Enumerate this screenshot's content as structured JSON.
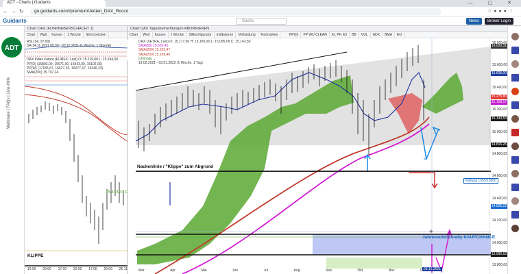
{
  "browser": {
    "tab_title": "ADT - Charts | Guidants",
    "url": "go.guidants.com/#premium/Aktien_DAX_Rocco"
  },
  "app": {
    "logo": "Guidants",
    "search_placeholder": "Suche",
    "news_label": "News",
    "broker_label": "Broker Login"
  },
  "left_strip": {
    "badge": "ADT",
    "vertical_text": "Webinare | FAQs | Live-Hilfe"
  },
  "left_chart": {
    "title": "Chart DAX (FUNKNEBENSCHACHT 1)",
    "toolbar": [
      "Chart",
      "Watt",
      "Kursen",
      "1 Woche",
      "Strichzeichen"
    ],
    "legend": [
      "RSI (14, 37.00)",
      "DA 14.11.2021 05:30 - 03.12.2021 (1 Woche, 1 Stunde)",
      "DAX Index Future (EUREX, Last) O: 15.119,00 L: 15.194,00",
      "PP(D) (15893,00, 15971,00, 15543,00, 15102,00)",
      "PP(W) (17185,67, 16627,33, 16077,67, 15346,33)",
      "SMA(200) 15.797,24"
    ],
    "price_label": "15.449,33 D",
    "klippe_label": "KLIPPE",
    "x_ticks": [
      "16:00",
      "20:00",
      "17:00",
      "20:00",
      "17:00",
      "20:00",
      "26.11"
    ]
  },
  "main_chart": {
    "title": "Chart DAX Tagesbetrachtungen ABONNIEREN",
    "toolbar": [
      "Chart",
      "Wert",
      "Kursen",
      "1 Woche",
      "Stilkonfigurator",
      "Indikatoren",
      "Verbindung",
      "Textmarken"
    ],
    "toolbar_right": [
      "PP(D)",
      "PP WU CLEAN",
      "KI, PF, E3",
      "BB",
      "VOL",
      "ADX",
      "BMA",
      "EO"
    ],
    "legend": [
      "DAX (XETRA, Last) O: 15.177,50 H: 15.185,00 L: 15.095,05 C: 15.143,50",
      "SMA(50) 15.535,45",
      "SMA(200) 15.222,47",
      "SMA(200) 15.169,40",
      "Ichimoku ..",
      "19.02.2021 - 03.01.2022 (1 Woche, 1 Tag)"
    ],
    "price_axis": [
      "16.020,00",
      "15.600,00",
      "15.400,00",
      "15.200,00",
      "15.000,00",
      "14.800,00",
      "14.600,00",
      "14.400,00",
      "14.200,00",
      "14.000,00",
      "13.800,00"
    ],
    "price_labels": [
      {
        "text": "16.020,31",
        "color": "#333333"
      },
      {
        "text": "15.605,00",
        "color": "#1f3f9f"
      },
      {
        "text": "15.275,80",
        "color": "#e53935"
      },
      {
        "text": "15.158,57",
        "color": "#c21fd1"
      },
      {
        "text": "15.143,50",
        "color": "#1a1a1a"
      },
      {
        "text": "14.816,26",
        "color": "#1a1a1a"
      },
      {
        "text": "14.505,22",
        "color": "#1f6fd1"
      },
      {
        "text": "13.996,62",
        "color": "#1a1a1a"
      }
    ],
    "annotations": {
      "neckline": "Nackenlinie / \"Klippe\" zum Abgrund",
      "range": "Rallung 1350/13800",
      "rally": "Jahresschlussrally KAUFCHANCE"
    },
    "x_axis": [
      "Mär",
      "Apr",
      "Mai",
      "Jun",
      "Jul",
      "Aug",
      "Sep",
      "Okt",
      "Nov",
      "Dez"
    ],
    "date_marker": "03.12.2021",
    "colors": {
      "cloud_green": "#5aa832",
      "cloud_red": "#e05a5a",
      "sma_red": "#c0392b",
      "sma_magenta": "#d21fd6",
      "kijun_blue": "#1f2f9f",
      "arrow_blue": "#1e88e5"
    }
  },
  "right_strip": {
    "items": [
      "avatar",
      "list",
      "avatar",
      "list",
      "avatar",
      "list",
      "avatar",
      "list",
      "avatar",
      "list",
      "avatar",
      "list",
      "avatar",
      "list",
      "avatar"
    ]
  }
}
